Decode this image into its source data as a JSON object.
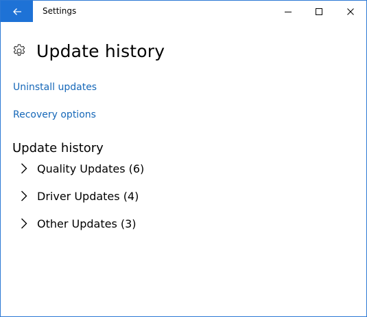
{
  "titlebar": {
    "title": "Settings",
    "back_icon": "arrow-left-icon",
    "controls": [
      "minimize-icon",
      "maximize-icon",
      "close-icon"
    ],
    "accent": "#1e72d6"
  },
  "header": {
    "icon": "gear-icon",
    "title": "Update history"
  },
  "links": {
    "uninstall": "Uninstall updates",
    "recovery": "Recovery options",
    "color": "#1567b8"
  },
  "history": {
    "section_title": "Update history",
    "categories": [
      {
        "label": "Quality Updates (6)",
        "icon": "chevron-right-icon"
      },
      {
        "label": "Driver Updates (4)",
        "icon": "chevron-right-icon"
      },
      {
        "label": "Other Updates (3)",
        "icon": "chevron-right-icon"
      }
    ]
  }
}
